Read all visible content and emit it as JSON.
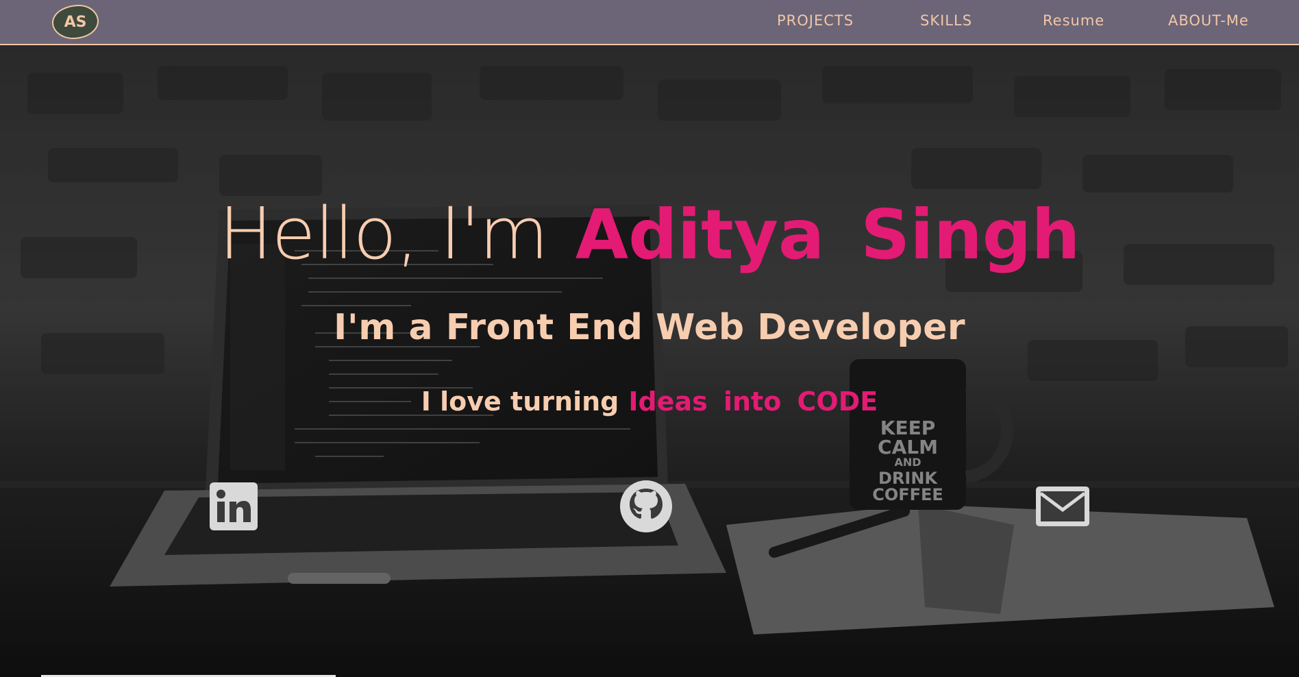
{
  "logo": {
    "text": "AS"
  },
  "nav": {
    "items": [
      {
        "label": "PROJECTS"
      },
      {
        "label": "SKILLS"
      },
      {
        "label": "Resume"
      },
      {
        "label": "ABOUT-Me"
      }
    ]
  },
  "hero": {
    "greeting": "Hello, I'm",
    "name": "Aditya Singh",
    "subtitle": "I'm a Front End Web Developer",
    "tagline_part1": "I love turning",
    "tagline_part2": "Ideas into CODE",
    "background_mug_text": [
      "KEEP",
      "CALM",
      "AND",
      "DRINK",
      "COFFEE"
    ]
  },
  "social": [
    {
      "icon": "linkedin-icon"
    },
    {
      "icon": "github-icon"
    },
    {
      "icon": "email-icon"
    }
  ],
  "colors": {
    "nav_bg": "#6b6577",
    "accent_peach": "#f7cdb0",
    "accent_pink": "#e31b74",
    "logo_bg": "#3e4a3b"
  }
}
